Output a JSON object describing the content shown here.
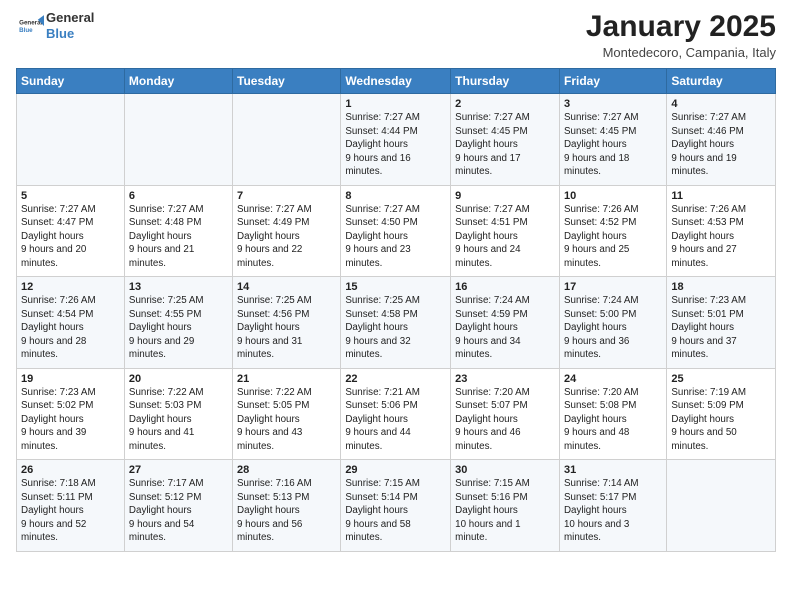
{
  "logo": {
    "general": "General",
    "blue": "Blue"
  },
  "header": {
    "month": "January 2025",
    "location": "Montedecoro, Campania, Italy"
  },
  "weekdays": [
    "Sunday",
    "Monday",
    "Tuesday",
    "Wednesday",
    "Thursday",
    "Friday",
    "Saturday"
  ],
  "weeks": [
    [
      {
        "day": null
      },
      {
        "day": null
      },
      {
        "day": null
      },
      {
        "day": "1",
        "sunrise": "7:27 AM",
        "sunset": "4:44 PM",
        "daylight": "9 hours and 16 minutes."
      },
      {
        "day": "2",
        "sunrise": "7:27 AM",
        "sunset": "4:45 PM",
        "daylight": "9 hours and 17 minutes."
      },
      {
        "day": "3",
        "sunrise": "7:27 AM",
        "sunset": "4:45 PM",
        "daylight": "9 hours and 18 minutes."
      },
      {
        "day": "4",
        "sunrise": "7:27 AM",
        "sunset": "4:46 PM",
        "daylight": "9 hours and 19 minutes."
      }
    ],
    [
      {
        "day": "5",
        "sunrise": "7:27 AM",
        "sunset": "4:47 PM",
        "daylight": "9 hours and 20 minutes."
      },
      {
        "day": "6",
        "sunrise": "7:27 AM",
        "sunset": "4:48 PM",
        "daylight": "9 hours and 21 minutes."
      },
      {
        "day": "7",
        "sunrise": "7:27 AM",
        "sunset": "4:49 PM",
        "daylight": "9 hours and 22 minutes."
      },
      {
        "day": "8",
        "sunrise": "7:27 AM",
        "sunset": "4:50 PM",
        "daylight": "9 hours and 23 minutes."
      },
      {
        "day": "9",
        "sunrise": "7:27 AM",
        "sunset": "4:51 PM",
        "daylight": "9 hours and 24 minutes."
      },
      {
        "day": "10",
        "sunrise": "7:26 AM",
        "sunset": "4:52 PM",
        "daylight": "9 hours and 25 minutes."
      },
      {
        "day": "11",
        "sunrise": "7:26 AM",
        "sunset": "4:53 PM",
        "daylight": "9 hours and 27 minutes."
      }
    ],
    [
      {
        "day": "12",
        "sunrise": "7:26 AM",
        "sunset": "4:54 PM",
        "daylight": "9 hours and 28 minutes."
      },
      {
        "day": "13",
        "sunrise": "7:25 AM",
        "sunset": "4:55 PM",
        "daylight": "9 hours and 29 minutes."
      },
      {
        "day": "14",
        "sunrise": "7:25 AM",
        "sunset": "4:56 PM",
        "daylight": "9 hours and 31 minutes."
      },
      {
        "day": "15",
        "sunrise": "7:25 AM",
        "sunset": "4:58 PM",
        "daylight": "9 hours and 32 minutes."
      },
      {
        "day": "16",
        "sunrise": "7:24 AM",
        "sunset": "4:59 PM",
        "daylight": "9 hours and 34 minutes."
      },
      {
        "day": "17",
        "sunrise": "7:24 AM",
        "sunset": "5:00 PM",
        "daylight": "9 hours and 36 minutes."
      },
      {
        "day": "18",
        "sunrise": "7:23 AM",
        "sunset": "5:01 PM",
        "daylight": "9 hours and 37 minutes."
      }
    ],
    [
      {
        "day": "19",
        "sunrise": "7:23 AM",
        "sunset": "5:02 PM",
        "daylight": "9 hours and 39 minutes."
      },
      {
        "day": "20",
        "sunrise": "7:22 AM",
        "sunset": "5:03 PM",
        "daylight": "9 hours and 41 minutes."
      },
      {
        "day": "21",
        "sunrise": "7:22 AM",
        "sunset": "5:05 PM",
        "daylight": "9 hours and 43 minutes."
      },
      {
        "day": "22",
        "sunrise": "7:21 AM",
        "sunset": "5:06 PM",
        "daylight": "9 hours and 44 minutes."
      },
      {
        "day": "23",
        "sunrise": "7:20 AM",
        "sunset": "5:07 PM",
        "daylight": "9 hours and 46 minutes."
      },
      {
        "day": "24",
        "sunrise": "7:20 AM",
        "sunset": "5:08 PM",
        "daylight": "9 hours and 48 minutes."
      },
      {
        "day": "25",
        "sunrise": "7:19 AM",
        "sunset": "5:09 PM",
        "daylight": "9 hours and 50 minutes."
      }
    ],
    [
      {
        "day": "26",
        "sunrise": "7:18 AM",
        "sunset": "5:11 PM",
        "daylight": "9 hours and 52 minutes."
      },
      {
        "day": "27",
        "sunrise": "7:17 AM",
        "sunset": "5:12 PM",
        "daylight": "9 hours and 54 minutes."
      },
      {
        "day": "28",
        "sunrise": "7:16 AM",
        "sunset": "5:13 PM",
        "daylight": "9 hours and 56 minutes."
      },
      {
        "day": "29",
        "sunrise": "7:15 AM",
        "sunset": "5:14 PM",
        "daylight": "9 hours and 58 minutes."
      },
      {
        "day": "30",
        "sunrise": "7:15 AM",
        "sunset": "5:16 PM",
        "daylight": "10 hours and 1 minute."
      },
      {
        "day": "31",
        "sunrise": "7:14 AM",
        "sunset": "5:17 PM",
        "daylight": "10 hours and 3 minutes."
      },
      {
        "day": null
      }
    ]
  ],
  "labels": {
    "sunrise": "Sunrise:",
    "sunset": "Sunset:",
    "daylight": "Daylight hours"
  }
}
